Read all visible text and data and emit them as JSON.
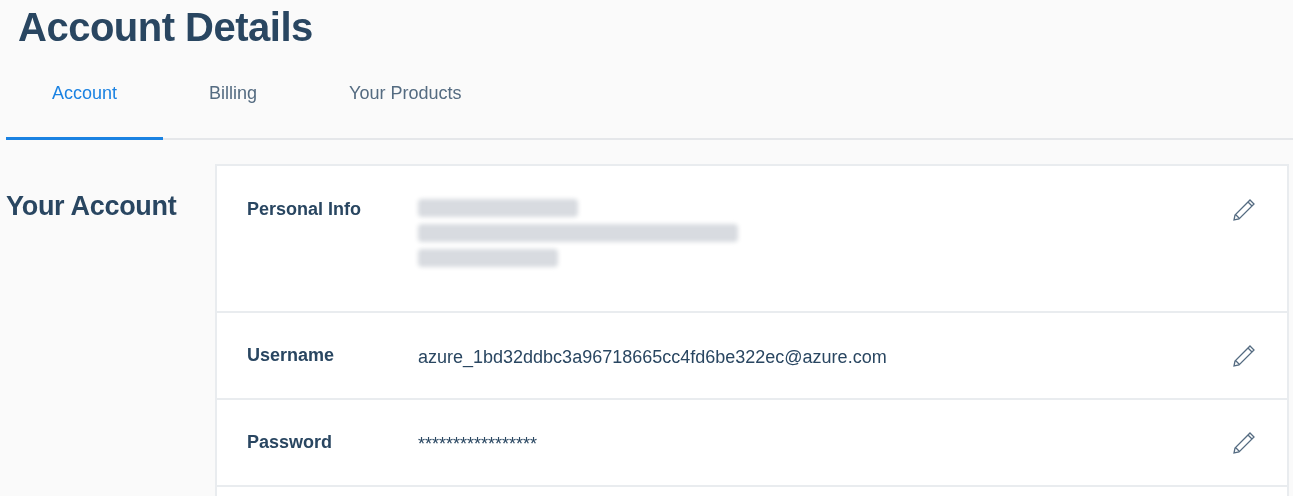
{
  "title": "Account Details",
  "tabs": [
    {
      "label": "Account",
      "selected": true
    },
    {
      "label": "Billing",
      "selected": false
    },
    {
      "label": "Your Products",
      "selected": false
    }
  ],
  "section": {
    "title": "Your Account",
    "rows": [
      {
        "label": "Personal Info",
        "values": [
          {
            "kind": "redacted"
          },
          {
            "kind": "redacted"
          },
          {
            "kind": "redacted"
          }
        ]
      },
      {
        "label": "Username",
        "values": [
          {
            "kind": "text",
            "text": "azure_1bd32ddbc3a96718665cc4fd6be322ec@azure.com"
          }
        ]
      },
      {
        "label": "Password",
        "values": [
          {
            "kind": "text",
            "text": "*****************"
          }
        ]
      }
    ]
  }
}
